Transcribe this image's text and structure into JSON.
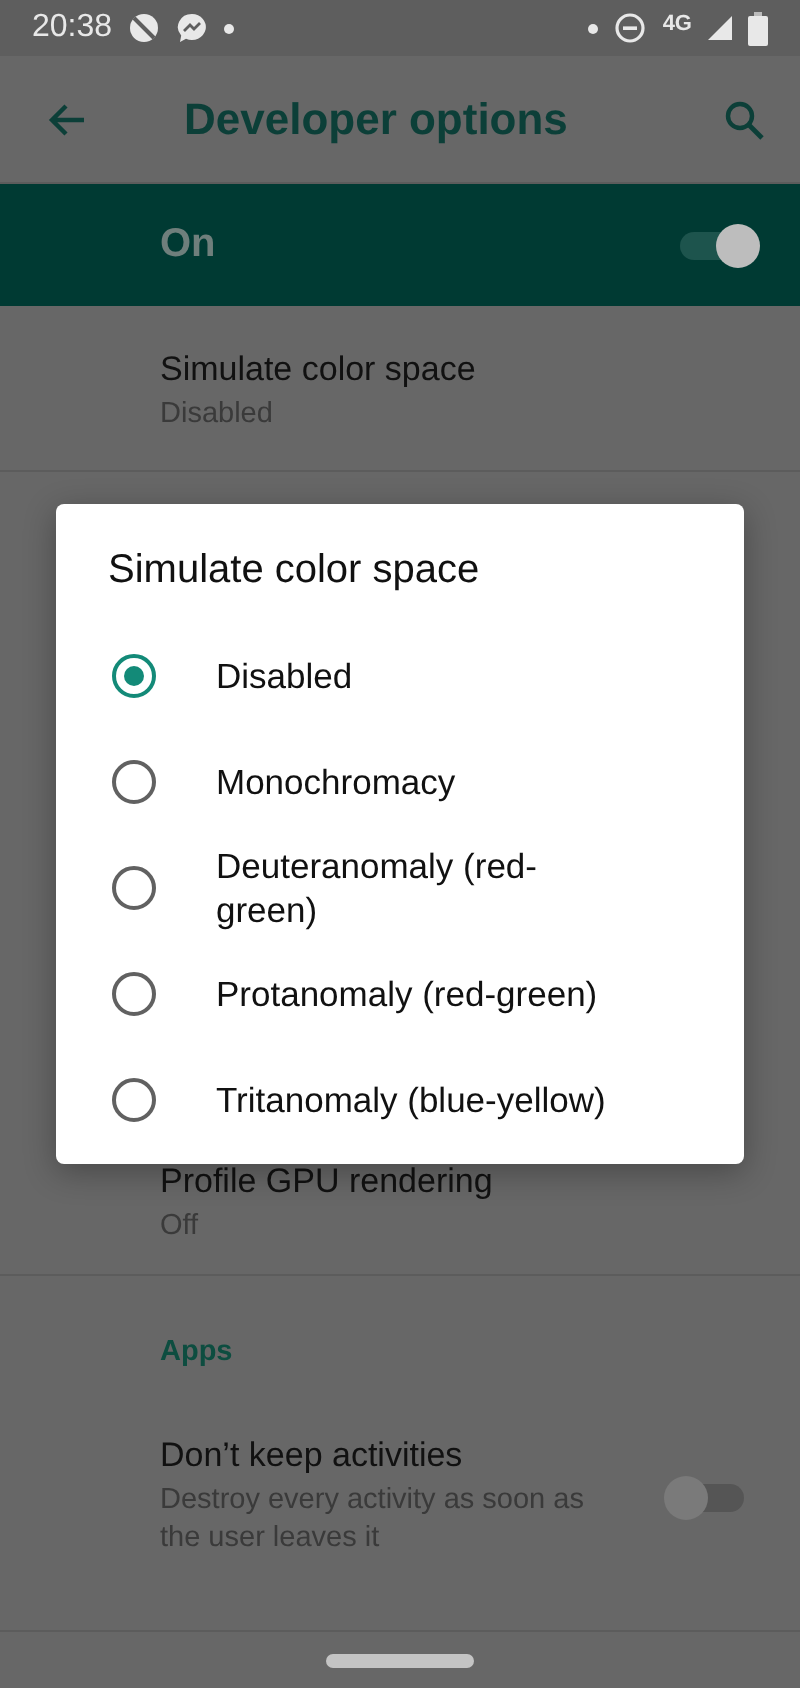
{
  "status_bar": {
    "time": "20:38",
    "network": "4G"
  },
  "toolbar": {
    "title": "Developer options"
  },
  "master_switch": {
    "label": "On",
    "on": true
  },
  "settings": [
    {
      "kind": "item",
      "title": "Simulate color space",
      "summary": "Disabled"
    },
    {
      "kind": "item",
      "title": "Profile GPU rendering",
      "summary": "Off"
    },
    {
      "kind": "header",
      "title": "Apps"
    },
    {
      "kind": "toggle",
      "title": "Don’t keep activities",
      "summary": "Destroy every activity as soon as the user leaves it",
      "on": false
    }
  ],
  "dialog": {
    "title": "Simulate color space",
    "options": [
      {
        "label": "Disabled",
        "selected": true
      },
      {
        "label": "Monochromacy",
        "selected": false
      },
      {
        "label": "Deuteranomaly (red-green)",
        "selected": false
      },
      {
        "label": "Protanomaly (red-green)",
        "selected": false
      },
      {
        "label": "Tritanomaly (blue-yellow)",
        "selected": false
      }
    ]
  }
}
